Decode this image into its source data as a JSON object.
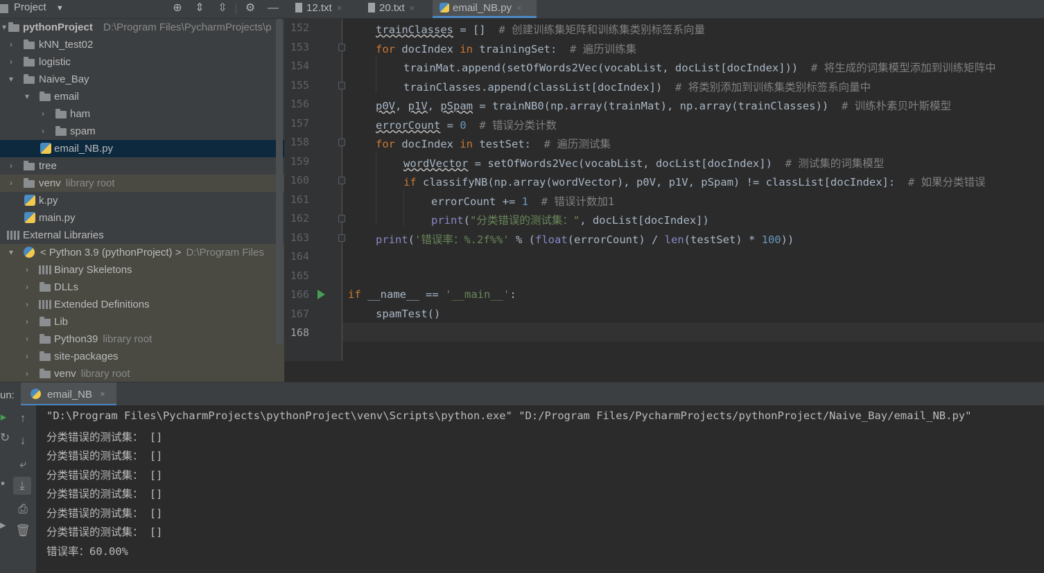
{
  "toolbar": {
    "project_label": "Project",
    "tabs": [
      {
        "label": "12.txt",
        "close": "×"
      },
      {
        "label": "20.txt",
        "close": "×"
      },
      {
        "label": "email_NB.py",
        "close": "×"
      }
    ]
  },
  "tree": {
    "root_name": "pythonProject",
    "root_path": "D:\\Program Files\\PycharmProjects\\p",
    "items": [
      {
        "label": "kNN_test02"
      },
      {
        "label": "logistic"
      },
      {
        "label": "Naive_Bay"
      },
      {
        "label": "email"
      },
      {
        "label": "ham"
      },
      {
        "label": "spam"
      },
      {
        "label": "email_NB.py"
      },
      {
        "label": "tree"
      },
      {
        "label": "venv",
        "hint": "library root"
      },
      {
        "label": "k.py"
      },
      {
        "label": "main.py"
      },
      {
        "label": "External Libraries"
      },
      {
        "label": "< Python 3.9 (pythonProject) >",
        "hint": "D:\\Program Files"
      },
      {
        "label": "Binary Skeletons"
      },
      {
        "label": "DLLs"
      },
      {
        "label": "Extended Definitions"
      },
      {
        "label": "Lib"
      },
      {
        "label": "Python39",
        "hint": "library root"
      },
      {
        "label": "site-packages"
      },
      {
        "label": "venv",
        "hint": "library root"
      }
    ]
  },
  "editor": {
    "line_numbers": [
      "152",
      "153",
      "154",
      "155",
      "156",
      "157",
      "158",
      "159",
      "160",
      "161",
      "162",
      "163",
      "164",
      "165",
      "166",
      "167",
      "168"
    ],
    "code": {
      "l152_var": "trainClasses",
      "l152_rest": " = []  ",
      "l152_cm": "# 创建训练集矩阵和训练集类别标签系向量",
      "l153_kw": "for",
      "l153_a": " docIndex ",
      "l153_kw2": "in",
      "l153_b": " trainingSet:  ",
      "l153_cm": "# 遍历训练集",
      "l154_code": "trainMat.append(setOfWords2Vec(vocabList, docList[docIndex]))  ",
      "l154_cm": "# 将生成的词集模型添加到训练矩阵中",
      "l155_code": "trainClasses.append(classList[docIndex])  ",
      "l155_cm": "# 将类别添加到训练集类别标签系向量中",
      "l156_v1": "p0V",
      "l156_c1": ", ",
      "l156_v2": "p1V",
      "l156_c2": ", ",
      "l156_v3": "pSpam",
      "l156_rest": " = trainNB0(np.array(trainMat), np.array(trainClasses))  ",
      "l156_cm": "# 训练朴素贝叶斯模型",
      "l157_var": "errorCount",
      "l157_eq": " = ",
      "l157_num": "0",
      "l157_sp": "  ",
      "l157_cm": "# 错误分类计数",
      "l158_kw": "for",
      "l158_a": " docIndex ",
      "l158_kw2": "in",
      "l158_b": " testSet:  ",
      "l158_cm": "# 遍历测试集",
      "l159_var": "wordVector",
      "l159_rest": " = setOfWords2Vec(vocabList, docList[docIndex])  ",
      "l159_cm": "# 测试集的词集模型",
      "l160_kw": "if",
      "l160_rest": " classifyNB(np.array(wordVector), p0V, p1V, pSpam) != classList[docIndex]:  ",
      "l160_cm": "# 如果分类错误",
      "l161_a": "errorCount += ",
      "l161_num": "1",
      "l161_sp": "  ",
      "l161_cm": "# 错误计数加1",
      "l162_bi": "print",
      "l162_p": "(",
      "l162_st": "\"分类错误的测试集：\"",
      "l162_rest": ", docList[docIndex])",
      "l163_bi": "print",
      "l163_p": "(",
      "l163_st": "'错误率：%.2f%%'",
      "l163_a": " % (",
      "l163_bi2": "float",
      "l163_b": "(errorCount) / ",
      "l163_bi3": "len",
      "l163_c": "(testSet) * ",
      "l163_num": "100",
      "l163_d": "))",
      "l166_kw": "if",
      "l166_a": " __name__ == ",
      "l166_st": "'__main__'",
      "l166_b": ":",
      "l167_code": "spamTest()"
    }
  },
  "run": {
    "label": "un:",
    "tab_label": "email_NB",
    "tab_close": "×",
    "output": [
      "\"D:\\Program Files\\PycharmProjects\\pythonProject\\venv\\Scripts\\python.exe\" \"D:/Program Files/PycharmProjects/pythonProject/Naive_Bay/email_NB.py\"",
      "分类错误的测试集： []",
      "分类错误的测试集： []",
      "分类错误的测试集： []",
      "分类错误的测试集： []",
      "分类错误的测试集： []",
      "分类错误的测试集： []",
      "错误率：60.00%"
    ]
  },
  "colors": {
    "keyword": "#cc7832",
    "comment": "#808080",
    "string": "#6a8759",
    "number": "#6897bb",
    "builtin": "#8888c6",
    "default_text": "#a9b7c6",
    "selection": "#0d293e",
    "accent": "#4a88c7"
  }
}
